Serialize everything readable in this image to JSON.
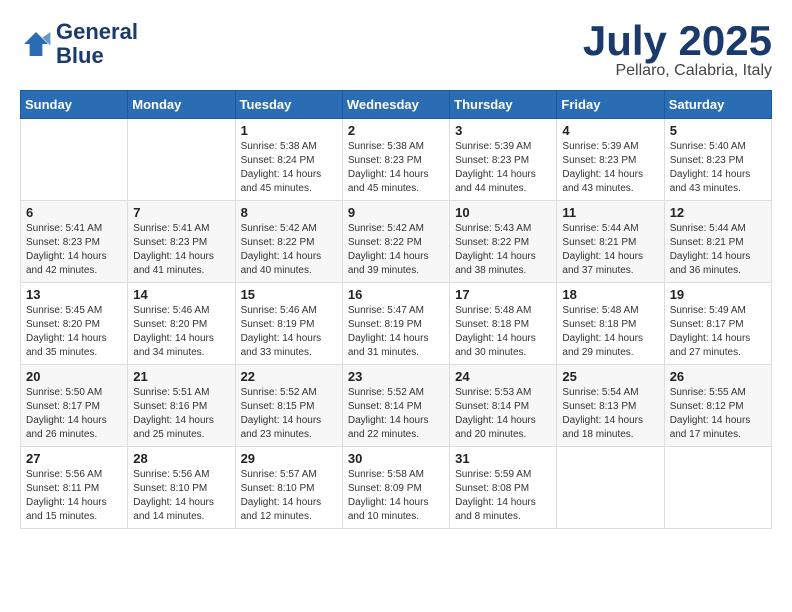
{
  "logo": {
    "line1": "General",
    "line2": "Blue"
  },
  "title": "July 2025",
  "subtitle": "Pellaro, Calabria, Italy",
  "days_header": [
    "Sunday",
    "Monday",
    "Tuesday",
    "Wednesday",
    "Thursday",
    "Friday",
    "Saturday"
  ],
  "weeks": [
    [
      {
        "day": "",
        "sunrise": "",
        "sunset": "",
        "daylight": ""
      },
      {
        "day": "",
        "sunrise": "",
        "sunset": "",
        "daylight": ""
      },
      {
        "day": "1",
        "sunrise": "Sunrise: 5:38 AM",
        "sunset": "Sunset: 8:24 PM",
        "daylight": "Daylight: 14 hours and 45 minutes."
      },
      {
        "day": "2",
        "sunrise": "Sunrise: 5:38 AM",
        "sunset": "Sunset: 8:23 PM",
        "daylight": "Daylight: 14 hours and 45 minutes."
      },
      {
        "day": "3",
        "sunrise": "Sunrise: 5:39 AM",
        "sunset": "Sunset: 8:23 PM",
        "daylight": "Daylight: 14 hours and 44 minutes."
      },
      {
        "day": "4",
        "sunrise": "Sunrise: 5:39 AM",
        "sunset": "Sunset: 8:23 PM",
        "daylight": "Daylight: 14 hours and 43 minutes."
      },
      {
        "day": "5",
        "sunrise": "Sunrise: 5:40 AM",
        "sunset": "Sunset: 8:23 PM",
        "daylight": "Daylight: 14 hours and 43 minutes."
      }
    ],
    [
      {
        "day": "6",
        "sunrise": "Sunrise: 5:41 AM",
        "sunset": "Sunset: 8:23 PM",
        "daylight": "Daylight: 14 hours and 42 minutes."
      },
      {
        "day": "7",
        "sunrise": "Sunrise: 5:41 AM",
        "sunset": "Sunset: 8:23 PM",
        "daylight": "Daylight: 14 hours and 41 minutes."
      },
      {
        "day": "8",
        "sunrise": "Sunrise: 5:42 AM",
        "sunset": "Sunset: 8:22 PM",
        "daylight": "Daylight: 14 hours and 40 minutes."
      },
      {
        "day": "9",
        "sunrise": "Sunrise: 5:42 AM",
        "sunset": "Sunset: 8:22 PM",
        "daylight": "Daylight: 14 hours and 39 minutes."
      },
      {
        "day": "10",
        "sunrise": "Sunrise: 5:43 AM",
        "sunset": "Sunset: 8:22 PM",
        "daylight": "Daylight: 14 hours and 38 minutes."
      },
      {
        "day": "11",
        "sunrise": "Sunrise: 5:44 AM",
        "sunset": "Sunset: 8:21 PM",
        "daylight": "Daylight: 14 hours and 37 minutes."
      },
      {
        "day": "12",
        "sunrise": "Sunrise: 5:44 AM",
        "sunset": "Sunset: 8:21 PM",
        "daylight": "Daylight: 14 hours and 36 minutes."
      }
    ],
    [
      {
        "day": "13",
        "sunrise": "Sunrise: 5:45 AM",
        "sunset": "Sunset: 8:20 PM",
        "daylight": "Daylight: 14 hours and 35 minutes."
      },
      {
        "day": "14",
        "sunrise": "Sunrise: 5:46 AM",
        "sunset": "Sunset: 8:20 PM",
        "daylight": "Daylight: 14 hours and 34 minutes."
      },
      {
        "day": "15",
        "sunrise": "Sunrise: 5:46 AM",
        "sunset": "Sunset: 8:19 PM",
        "daylight": "Daylight: 14 hours and 33 minutes."
      },
      {
        "day": "16",
        "sunrise": "Sunrise: 5:47 AM",
        "sunset": "Sunset: 8:19 PM",
        "daylight": "Daylight: 14 hours and 31 minutes."
      },
      {
        "day": "17",
        "sunrise": "Sunrise: 5:48 AM",
        "sunset": "Sunset: 8:18 PM",
        "daylight": "Daylight: 14 hours and 30 minutes."
      },
      {
        "day": "18",
        "sunrise": "Sunrise: 5:48 AM",
        "sunset": "Sunset: 8:18 PM",
        "daylight": "Daylight: 14 hours and 29 minutes."
      },
      {
        "day": "19",
        "sunrise": "Sunrise: 5:49 AM",
        "sunset": "Sunset: 8:17 PM",
        "daylight": "Daylight: 14 hours and 27 minutes."
      }
    ],
    [
      {
        "day": "20",
        "sunrise": "Sunrise: 5:50 AM",
        "sunset": "Sunset: 8:17 PM",
        "daylight": "Daylight: 14 hours and 26 minutes."
      },
      {
        "day": "21",
        "sunrise": "Sunrise: 5:51 AM",
        "sunset": "Sunset: 8:16 PM",
        "daylight": "Daylight: 14 hours and 25 minutes."
      },
      {
        "day": "22",
        "sunrise": "Sunrise: 5:52 AM",
        "sunset": "Sunset: 8:15 PM",
        "daylight": "Daylight: 14 hours and 23 minutes."
      },
      {
        "day": "23",
        "sunrise": "Sunrise: 5:52 AM",
        "sunset": "Sunset: 8:14 PM",
        "daylight": "Daylight: 14 hours and 22 minutes."
      },
      {
        "day": "24",
        "sunrise": "Sunrise: 5:53 AM",
        "sunset": "Sunset: 8:14 PM",
        "daylight": "Daylight: 14 hours and 20 minutes."
      },
      {
        "day": "25",
        "sunrise": "Sunrise: 5:54 AM",
        "sunset": "Sunset: 8:13 PM",
        "daylight": "Daylight: 14 hours and 18 minutes."
      },
      {
        "day": "26",
        "sunrise": "Sunrise: 5:55 AM",
        "sunset": "Sunset: 8:12 PM",
        "daylight": "Daylight: 14 hours and 17 minutes."
      }
    ],
    [
      {
        "day": "27",
        "sunrise": "Sunrise: 5:56 AM",
        "sunset": "Sunset: 8:11 PM",
        "daylight": "Daylight: 14 hours and 15 minutes."
      },
      {
        "day": "28",
        "sunrise": "Sunrise: 5:56 AM",
        "sunset": "Sunset: 8:10 PM",
        "daylight": "Daylight: 14 hours and 14 minutes."
      },
      {
        "day": "29",
        "sunrise": "Sunrise: 5:57 AM",
        "sunset": "Sunset: 8:10 PM",
        "daylight": "Daylight: 14 hours and 12 minutes."
      },
      {
        "day": "30",
        "sunrise": "Sunrise: 5:58 AM",
        "sunset": "Sunset: 8:09 PM",
        "daylight": "Daylight: 14 hours and 10 minutes."
      },
      {
        "day": "31",
        "sunrise": "Sunrise: 5:59 AM",
        "sunset": "Sunset: 8:08 PM",
        "daylight": "Daylight: 14 hours and 8 minutes."
      },
      {
        "day": "",
        "sunrise": "",
        "sunset": "",
        "daylight": ""
      },
      {
        "day": "",
        "sunrise": "",
        "sunset": "",
        "daylight": ""
      }
    ]
  ]
}
